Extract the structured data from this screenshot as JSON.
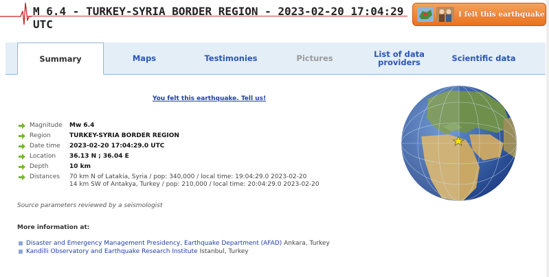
{
  "header": {
    "title": "M 6.4 - TURKEY-SYRIA BORDER REGION - 2023-02-20 17:04:29 UTC",
    "felt_button": "I felt this earthquake"
  },
  "tabs": [
    {
      "label": "Summary"
    },
    {
      "label": "Maps"
    },
    {
      "label": "Testimonies"
    },
    {
      "label": "Pictures"
    },
    {
      "label": "List of data providers"
    },
    {
      "label": "Scientific data"
    }
  ],
  "felt_link": "You felt this earthquake. Tell us!",
  "params": [
    {
      "key": "Magnitude",
      "value": "Mw 6.4"
    },
    {
      "key": "Region",
      "value": "TURKEY-SYRIA BORDER REGION"
    },
    {
      "key": "Date time",
      "value": "2023-02-20 17:04:29.0 UTC"
    },
    {
      "key": "Location",
      "value": "36.13 N ; 36.04 E"
    },
    {
      "key": "Depth",
      "value": "10 km"
    },
    {
      "key": "Distances",
      "value": "70 km N of Latakia, Syria / pop: 340,000 / local time: 19:04:29.0 2023-02-20",
      "value2": "14 km SW of Antakya, Turkey / pop: 210,000 / local time: 20:04:29.0 2023-02-20"
    }
  ],
  "reviewed": "Source parameters reviewed by a seismologist",
  "more_info": "More information at:",
  "sources": [
    {
      "link": "Disaster and Emergency Management Presidency, Earthquake Department (AFAD)",
      "rest": " Ankara, Turkey"
    },
    {
      "link": "Kandilli Observatory and Earthquake Research Institute",
      "rest": " Istanbul, Turkey"
    }
  ],
  "colors": {
    "accent": "#2a55b4",
    "button": "#e8721e",
    "tab_bg": "#e4eef7"
  }
}
